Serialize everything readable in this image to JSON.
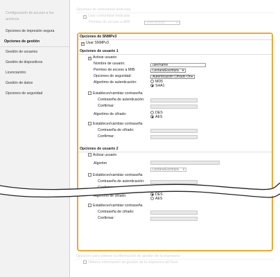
{
  "nav": {
    "items": [
      {
        "label": "Configuración de acceso a los",
        "dim": true
      },
      {
        "label": "archivos",
        "dim": true
      },
      {
        "label": "Opciones de impresión segura",
        "dim": false
      },
      {
        "label": "Opciones de gestión",
        "head": true
      },
      {
        "label": "Gestión de usuarios",
        "sub": true
      },
      {
        "label": "Gestión de dispositivos",
        "sub": true
      },
      {
        "label": "Licencia/otro",
        "sub": true
      },
      {
        "label": "Gestión de datos",
        "sub": true
      },
      {
        "label": "Opciones de seguridad",
        "sub": true
      }
    ]
  },
  "top": {
    "section_title": "Opciones de comunidad dedicada",
    "use_dedicated_community": "Usar comunidad dedicada",
    "mib_access_label": "Permiso de acceso a MIB:",
    "mib_access_value": "Sólo lectura"
  },
  "snmpv3": {
    "title": "Opciones de SNMPv3",
    "use_snmpv3": "Usar SNMPv3",
    "user1": {
      "title": "Opciones de usuario 1",
      "enable_user": "Activar usuario",
      "username_label": "Nombre de usuario:",
      "username_value": "username",
      "mib_label": "Permiso de acceso a MIB:",
      "mib_value": "Lectura/Escritura",
      "security_label": "Opciones de seguridad:",
      "security_value": "Autenticación Cifrado On",
      "auth_algo_label": "Algoritmo de autenticación:",
      "auth_opt1": "MD5",
      "auth_opt2": "SHA1",
      "set_auth_pw": "Establecer/cambiar contraseña",
      "auth_pw_label": "Contraseña de autenticación:",
      "confirm_label": "Confirmar:",
      "enc_algo_label": "Algoritmo de cifrado:",
      "enc_opt1": "DES",
      "enc_opt2": "AES",
      "set_enc_pw": "Establecer/cambiar contraseña",
      "enc_pw_label": "Contraseña de cifrado:",
      "confirm2_label": "Confirmar:"
    },
    "user2": {
      "title": "Opciones de usuario 2",
      "enable_user": "Activar usuario",
      "auth_algo_partial": "Algoritm",
      "mib_value_partial": "Lectura/Escritura",
      "set_auth_pw": "Establecer/cambiar contraseña",
      "auth_pw_label": "Contraseña de autenticación:",
      "confirm_label": "Confirmar:",
      "enc_algo_label": "Algoritmo de cifrado:",
      "enc_opt1": "DES",
      "enc_opt2": "AES",
      "set_enc_pw": "Establecer/cambiar contraseña",
      "enc_pw_label": "Contraseña de cifrado:",
      "confirm2_label": "Confirmar:"
    }
  },
  "bottom": {
    "section_title": "Opciones para obtener la información de gestión de la impresora",
    "get_info": "Obtener información de gestión de la impresora del host"
  },
  "colors": {
    "highlight": "#f0a732"
  }
}
